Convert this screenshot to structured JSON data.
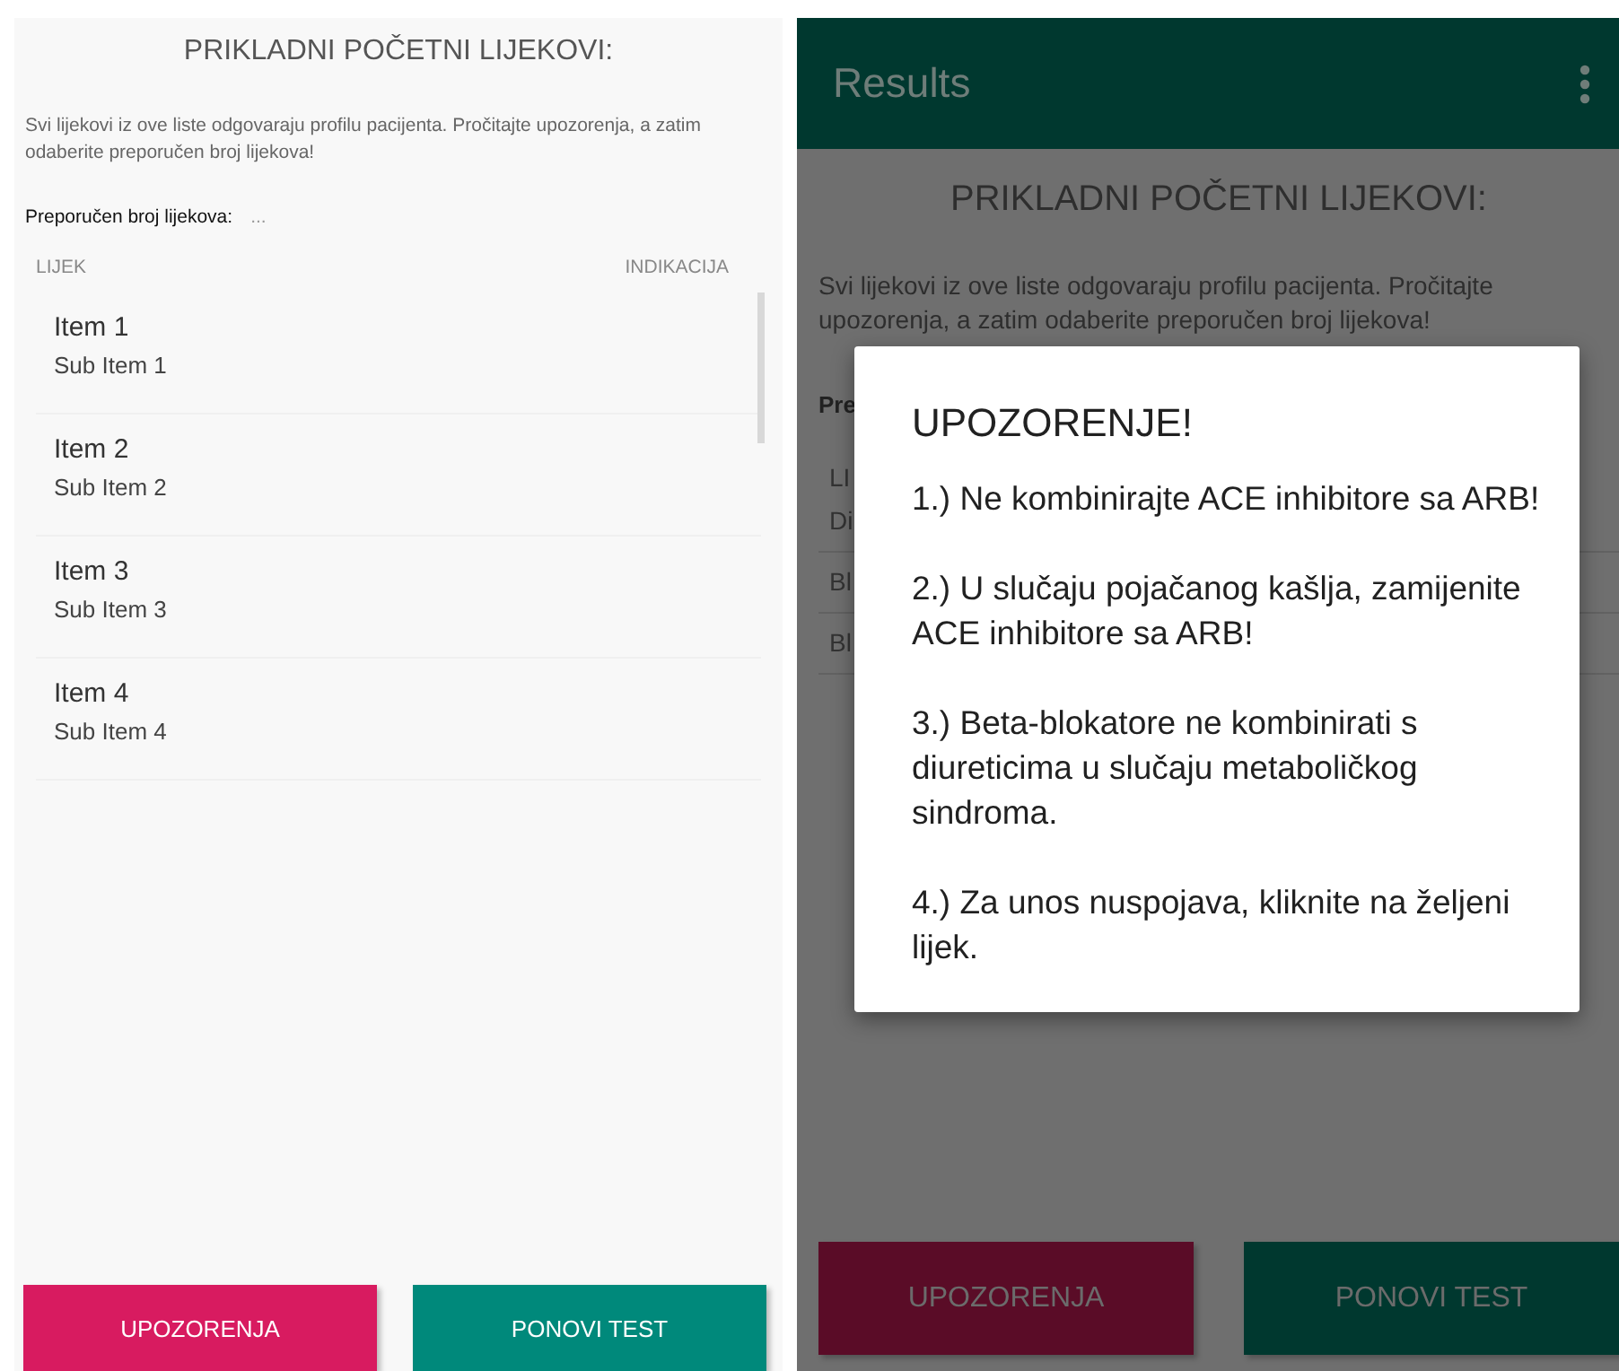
{
  "left_screen": {
    "title": "PRIKLADNI POČETNI LIJEKOVI:",
    "intro": "Svi lijekovi iz ove liste odgovaraju profilu pacijenta. Pročitajte upozorenja, a zatim odaberite preporučen broj lijekova!",
    "recommended": {
      "label": "Preporučen broj lijekova:",
      "value": "..."
    },
    "columns": [
      "LIJEK",
      "INDIKACIJA"
    ],
    "items": [
      {
        "title": "Item 1",
        "subtitle": "Sub Item 1"
      },
      {
        "title": "Item 2",
        "subtitle": "Sub Item 2"
      },
      {
        "title": "Item 3",
        "subtitle": "Sub Item 3"
      },
      {
        "title": "Item 4",
        "subtitle": "Sub Item 4"
      }
    ],
    "buttons": [
      {
        "label": "UPOZORENJA",
        "kind": "warning"
      },
      {
        "label": "PONOVI TEST",
        "kind": "retest"
      }
    ]
  },
  "right_screen": {
    "app_bar": {
      "title": "Results"
    },
    "title": "PRIKLADNI POČETNI LIJEKOVI:",
    "intro": "Svi lijekovi iz ove liste odgovaraju profilu pacijenta. Pročitajte upozorenja, a zatim odaberite preporučen broj lijekova!",
    "recommended_label": "Pre",
    "header_fragment": "LI",
    "row_fragments": [
      "Di",
      "Bl",
      "Bl"
    ],
    "buttons": [
      {
        "label": "UPOZORENJA",
        "kind": "warning"
      },
      {
        "label": "PONOVI TEST",
        "kind": "retest"
      }
    ],
    "dialog": {
      "title": "UPOZORENJE!",
      "paragraphs": [
        "1.) Ne kombinirajte ACE inhibitore sa ARB!",
        "2.) U slučaju pojačanog kašlja, zamijenite ACE inhibitore sa ARB!",
        "3.) Beta-blokatore ne kombinirati s diureticima u slučaju metaboličkog sindroma.",
        "4.) Za unos nuspojava, kliknite na željeni lijek."
      ]
    }
  }
}
